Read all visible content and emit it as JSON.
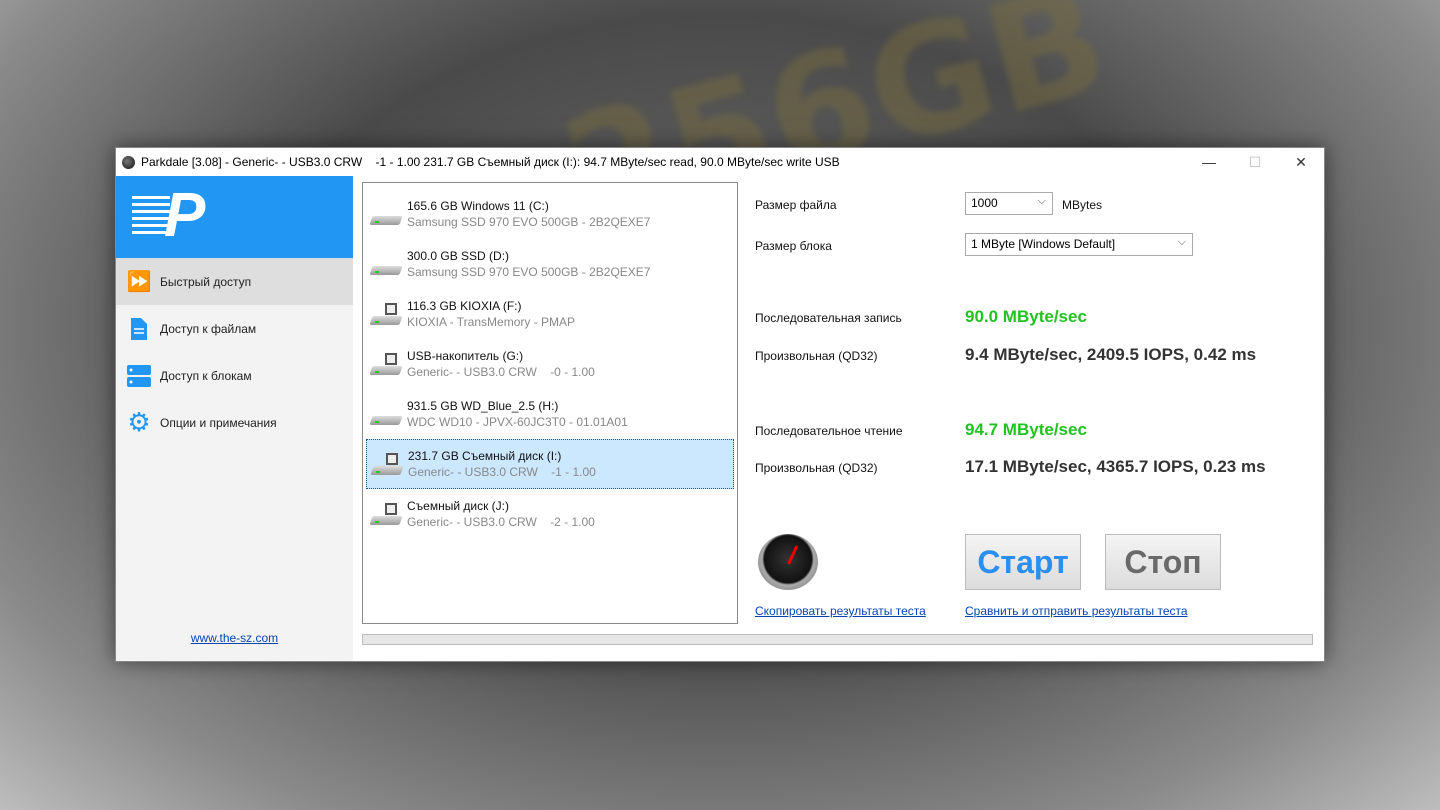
{
  "window": {
    "title": "Parkdale [3.08] - Generic- - USB3.0 CRW    -1 - 1.00 231.7 GB Съемный диск (I:): 94.7 MByte/sec read, 90.0 MByte/sec write USB",
    "minimize": "—",
    "maximize": "☐",
    "close": "✕"
  },
  "sidebar": {
    "items": [
      {
        "label": "Быстрый доступ",
        "icon": "fast-forward-icon"
      },
      {
        "label": "Доступ к файлам",
        "icon": "file-icon"
      },
      {
        "label": "Доступ к блокам",
        "icon": "blocks-icon"
      },
      {
        "label": "Опции и примечания",
        "icon": "gear-icon"
      }
    ],
    "website": "www.the-sz.com"
  },
  "drives": [
    {
      "name": "165.6 GB Windows 11 (C:)",
      "detail": "Samsung SSD 970 EVO 500GB - 2B2QEXE7",
      "removable": false
    },
    {
      "name": "300.0 GB SSD (D:)",
      "detail": "Samsung SSD 970 EVO 500GB - 2B2QEXE7",
      "removable": false
    },
    {
      "name": "116.3 GB KIOXIA (F:)",
      "detail": "KIOXIA - TransMemory - PMAP",
      "removable": true
    },
    {
      "name": "USB-накопитель (G:)",
      "detail": "Generic- - USB3.0 CRW    -0 - 1.00",
      "removable": true
    },
    {
      "name": "931.5 GB WD_Blue_2.5 (H:)",
      "detail": "WDC WD10 - JPVX-60JC3T0 - 01.01A01",
      "removable": false
    },
    {
      "name": "231.7 GB Съемный диск (I:)",
      "detail": "Generic- - USB3.0 CRW    -1 - 1.00",
      "removable": true,
      "selected": true
    },
    {
      "name": "Съемный диск (J:)",
      "detail": "Generic- - USB3.0 CRW    -2 - 1.00",
      "removable": true
    }
  ],
  "settings": {
    "file_size_label": "Размер файла",
    "file_size_value": "1000",
    "file_size_unit": "MBytes",
    "block_size_label": "Размер блока",
    "block_size_value": "1 MByte [Windows Default]"
  },
  "results": {
    "seq_write_label": "Последовательная запись",
    "seq_write": "90.0 MByte/sec",
    "rand_write_label": "Произвольная (QD32)",
    "rand_write": "9.4 MByte/sec, 2409.5 IOPS, 0.42 ms",
    "seq_read_label": "Последовательное чтение",
    "seq_read": "94.7 MByte/sec",
    "rand_read_label": "Произвольная (QD32)",
    "rand_read": "17.1 MByte/sec, 4365.7 IOPS, 0.23 ms"
  },
  "actions": {
    "start": "Старт",
    "stop": "Стоп",
    "copy_link": "Скопировать результаты теста",
    "compare_link": "Сравнить и отправить результаты теста"
  },
  "progress": 0
}
